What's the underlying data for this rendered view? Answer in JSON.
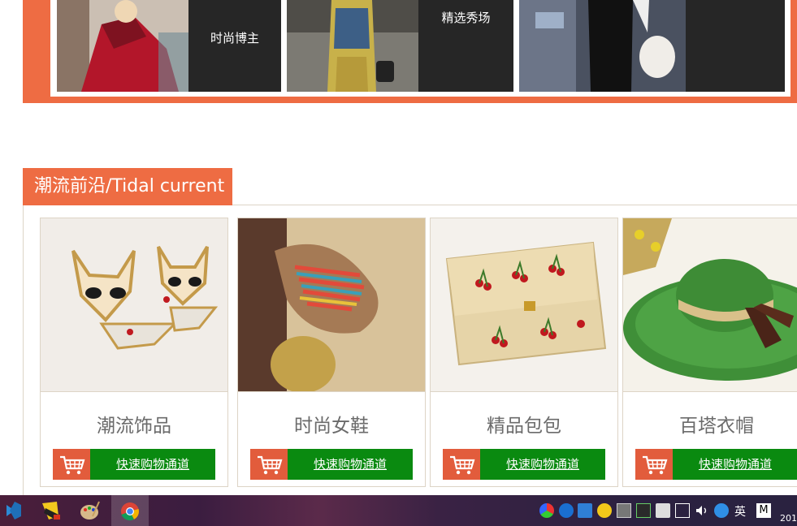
{
  "banner": {
    "tiles": [
      {
        "label": "时尚博主"
      },
      {
        "label": "精选秀场"
      },
      {
        "label": ""
      }
    ]
  },
  "section": {
    "title": "潮流前沿/Tidal current"
  },
  "products": [
    {
      "name": "潮流饰品",
      "button": "快速购物通道"
    },
    {
      "name": "时尚女鞋",
      "button": "快速购物通道"
    },
    {
      "name": "精品包包",
      "button": "快速购物通道"
    },
    {
      "name": "百塔衣帽",
      "button": "快速购物通道"
    }
  ],
  "taskbar": {
    "ime": "英",
    "clock_partial": "201"
  },
  "colors": {
    "accent": "#ee6c43",
    "buy_green": "#0a8a10",
    "cart_red": "#e25c3c"
  }
}
